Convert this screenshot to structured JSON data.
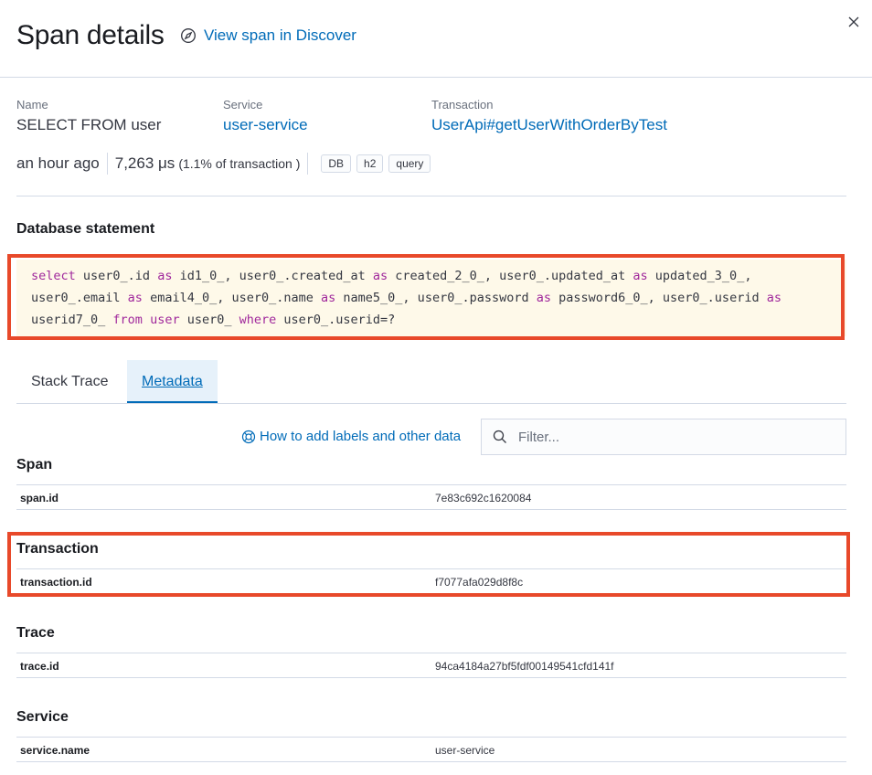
{
  "header": {
    "title": "Span details",
    "discover_link": "View span in Discover",
    "close_icon": "close-icon"
  },
  "summary": {
    "name": {
      "label": "Name",
      "value": "SELECT FROM user"
    },
    "service": {
      "label": "Service",
      "value": "user-service"
    },
    "transaction": {
      "label": "Transaction",
      "value": "UserApi#getUserWithOrderByTest"
    }
  },
  "meta": {
    "time": "an hour ago",
    "duration": "7,263 μs",
    "percent": "(1.1% of transaction )",
    "badges": [
      "DB",
      "h2",
      "query"
    ]
  },
  "database": {
    "heading": "Database statement"
  },
  "tabs": [
    {
      "label": "Stack Trace",
      "active": false
    },
    {
      "label": "Metadata",
      "active": true
    }
  ],
  "help_link": "How to add labels and other data",
  "filter": {
    "placeholder": "Filter..."
  },
  "sections": [
    {
      "title": "Span",
      "key": "span.id",
      "value": "7e83c692c1620084"
    },
    {
      "title": "Transaction",
      "key": "transaction.id",
      "value": "f7077afa029d8f8c"
    },
    {
      "title": "Trace",
      "key": "trace.id",
      "value": "94ca4184a27bf5fdf00149541cfd141f"
    },
    {
      "title": "Service",
      "key": "service.name",
      "value": "user-service"
    }
  ],
  "colors": {
    "link": "#006bb8",
    "keyword": "#a0289c",
    "code_background": "#fef9e9",
    "highlight_frame": "#e8492a"
  }
}
